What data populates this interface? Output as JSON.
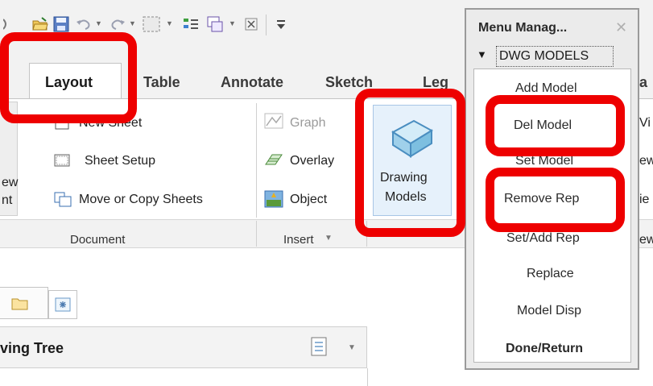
{
  "tabs": {
    "layout": "Layout",
    "table": "Table",
    "annotate": "Annotate",
    "sketch": "Sketch",
    "legacy": "Leg"
  },
  "ribbon": {
    "new_sheet": "New Sheet",
    "sheet_setup": "Sheet Setup",
    "move_copy": "Move or Copy Sheets",
    "left_partial_1": "ew",
    "left_partial_2": "nt",
    "graph": "Graph",
    "overlay": "Overlay",
    "object": "Object",
    "drawing_models_line1": "Drawing",
    "drawing_models_line2": "Models",
    "group_document": "Document",
    "group_insert": "Insert"
  },
  "ribbon_right": {
    "row1": "a",
    "row2": "Vi",
    "row3": "ew",
    "row4": "ie",
    "row5": "ew"
  },
  "tree": {
    "title": "ving Tree"
  },
  "menu_manager": {
    "title": "Menu Manag...",
    "section": "DWG MODELS",
    "items": [
      "Add Model",
      "Del Model",
      "Set Model",
      "Remove Rep",
      "Set/Add Rep",
      "Replace",
      "Model Disp",
      "Done/Return"
    ]
  },
  "colors": {
    "highlight": "#ee0000",
    "ribbon_bg": "#f2f2f2",
    "button_blue": "#8ecbe6"
  },
  "icons": [
    "open-folder-icon",
    "save-icon",
    "undo-icon",
    "redo-icon",
    "select-box-icon",
    "regenerate-icon",
    "window-icon",
    "close-window-icon",
    "customize-icon",
    "new-sheet-icon",
    "sheet-setup-icon",
    "move-copy-icon",
    "graph-icon",
    "overlay-icon",
    "object-icon",
    "drawing-models-icon",
    "folder-icon",
    "tree-settings-icon",
    "close-icon",
    "triangle-down-icon"
  ]
}
